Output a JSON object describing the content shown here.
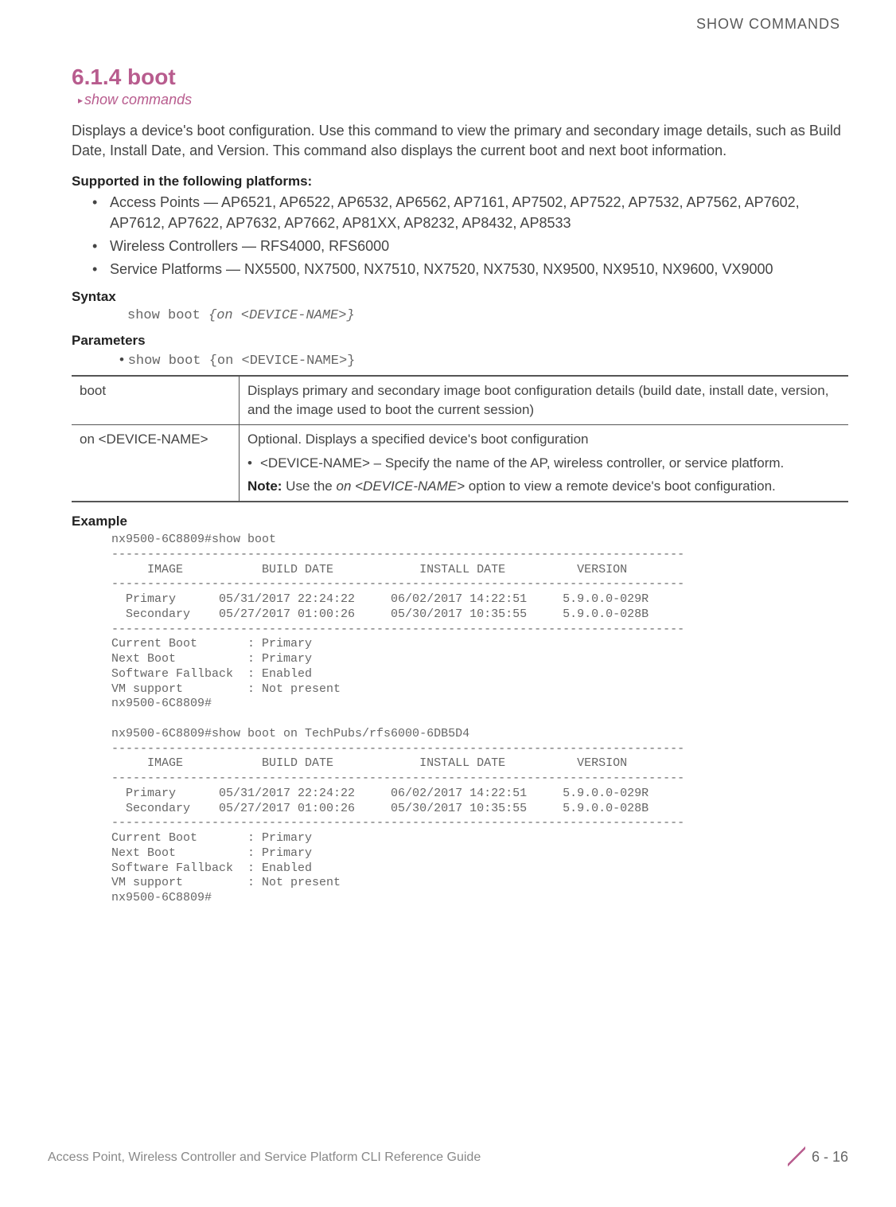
{
  "header": {
    "right_title": "SHOW COMMANDS"
  },
  "section": {
    "number_title": "6.1.4 boot",
    "breadcrumb": "show commands",
    "description": "Displays a device's boot configuration. Use this command to view the primary and secondary image details, such as Build Date, Install Date, and Version. This command also displays the current boot and next boot information."
  },
  "platforms": {
    "heading": "Supported in the following platforms:",
    "items": [
      "Access Points — AP6521, AP6522, AP6532, AP6562, AP7161, AP7502, AP7522, AP7532, AP7562, AP7602, AP7612, AP7622, AP7632, AP7662, AP81XX, AP8232, AP8432, AP8533",
      "Wireless Controllers — RFS4000, RFS6000",
      "Service Platforms — NX5500, NX7500, NX7510, NX7520, NX7530, NX9500, NX9510, NX9600, VX9000"
    ]
  },
  "syntax": {
    "heading": "Syntax",
    "line_plain": "show boot ",
    "line_italic": "{on <DEVICE-NAME>}"
  },
  "parameters": {
    "heading": "Parameters",
    "param_line_plain": "show boot ",
    "param_line_italic": "{on <DEVICE-NAME>}",
    "rows": [
      {
        "name": "boot",
        "desc": "Displays primary and secondary image boot configuration details (build date, install date, version, and the image used to boot the current session)"
      },
      {
        "name": "on <DEVICE-NAME>",
        "desc_line1": "Optional. Displays a specified device's boot configuration",
        "desc_bullet": "<DEVICE-NAME> – Specify the name of the AP, wireless controller, or service platform.",
        "note_label": "Note:",
        "note_before": " Use the ",
        "note_italic": "on <DEVICE-NAME>",
        "note_after": " option to view a remote device's boot configuration."
      }
    ]
  },
  "example": {
    "heading": "Example",
    "text": "nx9500-6C8809#show boot\n--------------------------------------------------------------------------------\n     IMAGE           BUILD DATE            INSTALL DATE          VERSION\n--------------------------------------------------------------------------------\n  Primary      05/31/2017 22:24:22     06/02/2017 14:22:51     5.9.0.0-029R\n  Secondary    05/27/2017 01:00:26     05/30/2017 10:35:55     5.9.0.0-028B\n--------------------------------------------------------------------------------\nCurrent Boot       : Primary\nNext Boot          : Primary\nSoftware Fallback  : Enabled\nVM support         : Not present\nnx9500-6C8809#\n\nnx9500-6C8809#show boot on TechPubs/rfs6000-6DB5D4\n--------------------------------------------------------------------------------\n     IMAGE           BUILD DATE            INSTALL DATE          VERSION\n--------------------------------------------------------------------------------\n  Primary      05/31/2017 22:24:22     06/02/2017 14:22:51     5.9.0.0-029R\n  Secondary    05/27/2017 01:00:26     05/30/2017 10:35:55     5.9.0.0-028B\n--------------------------------------------------------------------------------\nCurrent Boot       : Primary\nNext Boot          : Primary\nSoftware Fallback  : Enabled\nVM support         : Not present\nnx9500-6C8809#"
  },
  "footer": {
    "left": "Access Point, Wireless Controller and Service Platform CLI Reference Guide",
    "page": "6 - 16"
  }
}
